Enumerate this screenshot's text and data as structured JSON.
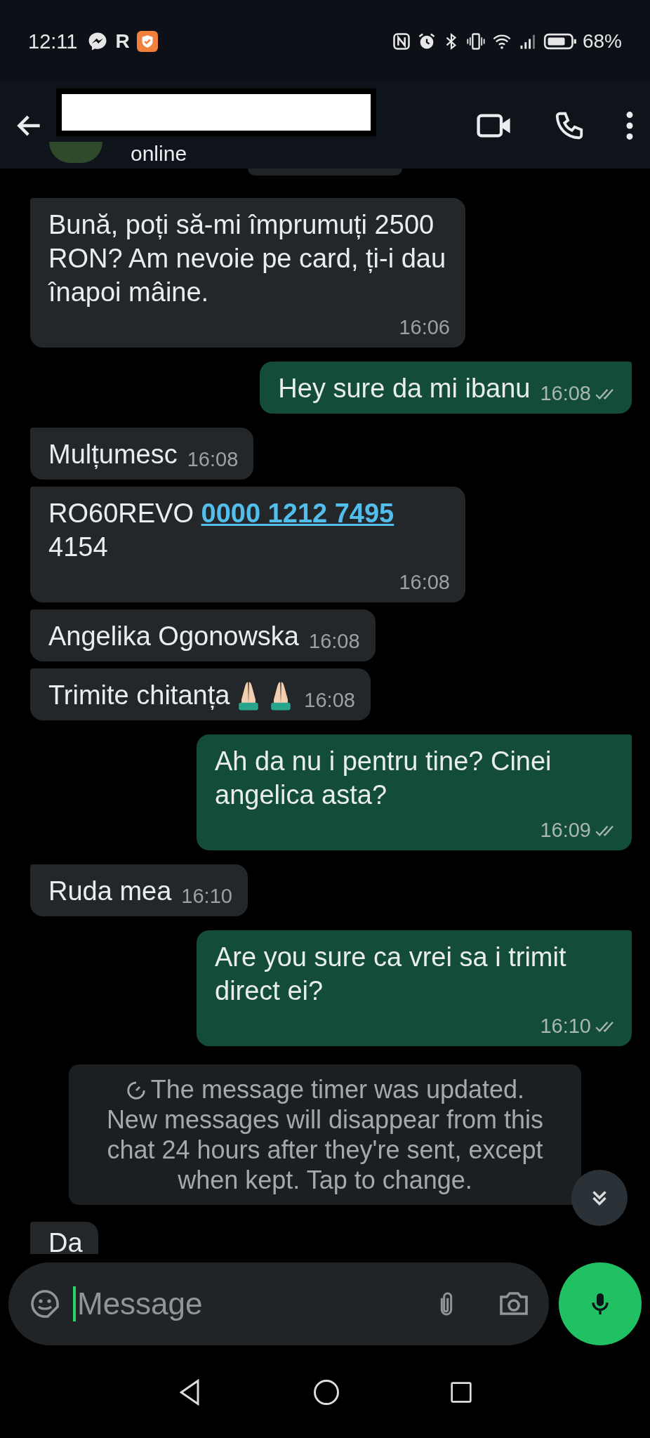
{
  "status_bar": {
    "time": "12:11",
    "app_letter": "R",
    "battery": "68%"
  },
  "header": {
    "status": "online"
  },
  "messages": [
    {
      "kind": "incoming",
      "parts": [
        {
          "kind": "text",
          "text": "Bună, poți să-mi împrumuți 2500 RON? Am nevoie pe card, ți-i dau înapoi mâine."
        }
      ],
      "time": "16:06"
    },
    {
      "kind": "outgoing",
      "parts": [
        {
          "kind": "text",
          "text": "Hey sure da mi ibanu"
        }
      ],
      "time": "16:08"
    },
    {
      "kind": "incoming",
      "parts": [
        {
          "kind": "text",
          "text": "Mulțumesc"
        }
      ],
      "time": "16:08"
    },
    {
      "kind": "incoming",
      "parts": [
        {
          "kind": "text",
          "text": "RO60REVO "
        },
        {
          "kind": "link",
          "text": "0000 1212 7495"
        },
        {
          "kind": "text",
          "text": "\n4154"
        }
      ],
      "time": "16:08"
    },
    {
      "kind": "incoming",
      "parts": [
        {
          "kind": "text",
          "text": "Angelika Ogonowska"
        }
      ],
      "time": "16:08"
    },
    {
      "kind": "incoming",
      "parts": [
        {
          "kind": "text",
          "text": "Trimite chitanța"
        },
        {
          "kind": "pray"
        },
        {
          "kind": "pray"
        }
      ],
      "time": "16:08"
    },
    {
      "kind": "outgoing",
      "parts": [
        {
          "kind": "text",
          "text": "Ah da nu i pentru tine? Cinei angelica asta?"
        }
      ],
      "time": "16:09"
    },
    {
      "kind": "incoming",
      "parts": [
        {
          "kind": "text",
          "text": "Ruda mea"
        }
      ],
      "time": "16:10"
    },
    {
      "kind": "outgoing",
      "parts": [
        {
          "kind": "text",
          "text": "Are you sure ca vrei sa i trimit direct ei?"
        }
      ],
      "time": "16:10"
    },
    {
      "kind": "system",
      "text": "The message timer was updated. New messages will disappear from this chat 24 hours after they're sent, except when kept. Tap to change."
    },
    {
      "kind": "incoming",
      "cut": true,
      "parts": [
        {
          "kind": "text",
          "text": "Da"
        }
      ]
    }
  ],
  "composer": {
    "placeholder": "Message"
  }
}
